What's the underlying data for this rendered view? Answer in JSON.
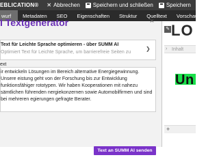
{
  "topbar": {
    "app_label": "EBLICATION®",
    "abort": "Abbrechen",
    "save_close": "Speichern und schließen",
    "save": "Speichern"
  },
  "tabs": [
    {
      "label": "wurf",
      "active": true
    },
    {
      "label": "Metadaten",
      "active": false
    },
    {
      "label": "SEO",
      "active": false
    },
    {
      "label": "Eigenschaften",
      "active": false
    },
    {
      "label": "Struktur",
      "active": false
    },
    {
      "label": "Quelltext",
      "active": false
    },
    {
      "label": "Vorschau",
      "active": false
    }
  ],
  "panel": {
    "title": "I Textgenerator",
    "close": "×",
    "select_value": "Text für Leichte Sprache optimieren - über SUMM AI",
    "select_desc": "Optimiert Text für Leichte Sprache, um barrierefreie Seiten zu",
    "field_label": "ext",
    "textarea_value": "ir entwickeln Lösungen im Bereich alternative Energiegewinnung. Unsere eistung geht von der Forschung bis zur Entwicklung funktionsfähiger rototypen. Wir haben Kooperationen mit nahezu sämtlichen führenden nergiekonzernen sowie Automobilfirmen und sind bei mehreren egierungen gefragte Berater.",
    "send_button": "Text an SUMM AI senden"
  },
  "preview": {
    "heading": "LO",
    "row_label": "Inhalt",
    "un_text": "Un",
    "plus": "+"
  },
  "colors": {
    "accent": "#7a33c9",
    "title": "#6a2fb5",
    "topbar": "#3c3c3c",
    "tabbar": "#2b2b2b",
    "highlight": "#19e04a"
  },
  "icons": {
    "abort": "close-icon",
    "save_close": "save-icon",
    "save": "save-icon",
    "select": "chevron-down-icon",
    "edit": "pencil-icon",
    "row": "chevron-right-icon"
  }
}
